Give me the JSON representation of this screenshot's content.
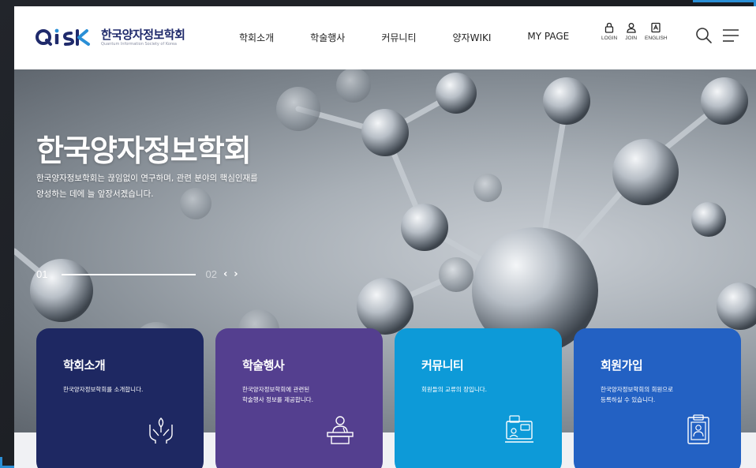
{
  "header": {
    "logo_mark": "QiSK",
    "logo_kor": "한국양자정보학회",
    "logo_eng": "Quantum Information Society of Korea",
    "nav": [
      "학회소개",
      "학술행사",
      "커뮤니티",
      "양자WIKI",
      "MY PAGE"
    ],
    "util": {
      "login": "LOGIN",
      "join": "JOIN",
      "english": "ENGLISH"
    }
  },
  "hero": {
    "title": "한국양자정보학회",
    "desc_line1": "한국양자정보학회는 끊임없이 연구하며, 관련 분야의 핵심인재를",
    "desc_line2": "양성하는 데에 늘 앞장서겠습니다.",
    "slide_current": "01",
    "slide_next": "02",
    "prev": "‹",
    "next": "›"
  },
  "cards": [
    {
      "title": "학회소개",
      "desc1": "한국양자정보학회를 소개합니다.",
      "desc2": "",
      "color": "#1e2862"
    },
    {
      "title": "학술행사",
      "desc1": "한국양자정보학회에 관련된",
      "desc2": "학술행사 정보를 제공합니다.",
      "color": "#543f8f"
    },
    {
      "title": "커뮤니티",
      "desc1": "회원들의 교류의 장입니다.",
      "desc2": "",
      "color": "#0d9ad8"
    },
    {
      "title": "회원가입",
      "desc1": "한국양자정보학회의 회원으로",
      "desc2": "등록하실 수 있습니다.",
      "color": "#2361c3"
    }
  ],
  "colors": {
    "navy": "#1f2a6b",
    "accent": "#2a8fd6"
  }
}
